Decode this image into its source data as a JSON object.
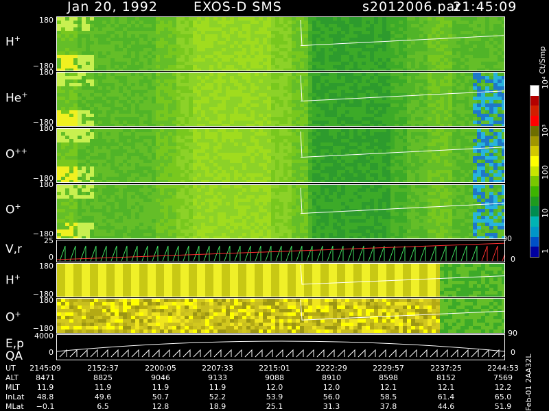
{
  "header": {
    "date": "Jan 20, 1992",
    "instrument": "EXOS-D SMS",
    "file": "s2012006.par",
    "time": "21:45:09"
  },
  "panels": [
    {
      "id": "h-plus",
      "label": "H",
      "sup": "+",
      "ticks": [
        "180",
        "−180"
      ]
    },
    {
      "id": "he-plus",
      "label": "He",
      "sup": "+",
      "ticks": [
        "180",
        "−180"
      ]
    },
    {
      "id": "o-plusplus",
      "label": "O",
      "sup": "++",
      "ticks": [
        "180",
        "−180"
      ]
    },
    {
      "id": "o-plus",
      "label": "O",
      "sup": "+",
      "ticks": [
        "180",
        "−180"
      ]
    },
    {
      "id": "vr",
      "label": "V,r",
      "sup": "",
      "ticks": [
        "25",
        "0"
      ],
      "right_ticks": [
        "90",
        "0"
      ]
    },
    {
      "id": "h-plus-2",
      "label": "H",
      "sup": "+",
      "ticks": [
        "180",
        "−180"
      ]
    },
    {
      "id": "o-plus-2",
      "label": "O",
      "sup": "+",
      "ticks": [
        "180",
        "−180"
      ]
    },
    {
      "id": "ep-qa",
      "label": "E,p",
      "label2": "QA",
      "ticks": [
        "4000",
        "0"
      ],
      "right_ticks": [
        "90",
        "0"
      ]
    }
  ],
  "colorbar": {
    "unit": "Ct/Smp",
    "labels": [
      "10⁴",
      "10³",
      "100",
      "10",
      "1"
    ],
    "colors": [
      "#ffffff",
      "#b40000",
      "#d21e00",
      "#ff0000",
      "#6e6e00",
      "#a09600",
      "#d2c800",
      "#ffff00",
      "#c8e600",
      "#78c800",
      "#3cb400",
      "#1e9b1e",
      "#008c50",
      "#00b4b4",
      "#0096c8",
      "#0050c8",
      "#0000a0"
    ]
  },
  "time_table": {
    "row_labels": [
      "UT",
      "ALT",
      "MLT",
      "InLat",
      "MLat"
    ],
    "columns": [
      [
        "2145:09",
        "8471",
        "11.9",
        "48.8",
        "−0.1"
      ],
      [
        "2152:37",
        "8825",
        "11.9",
        "49.6",
        "6.5"
      ],
      [
        "2200:05",
        "9046",
        "11.9",
        "50.7",
        "12.8"
      ],
      [
        "2207:33",
        "9133",
        "11.9",
        "52.2",
        "18.9"
      ],
      [
        "2215:01",
        "9088",
        "12.0",
        "53.9",
        "25.1"
      ],
      [
        "2222:29",
        "8910",
        "12.0",
        "56.0",
        "31.3"
      ],
      [
        "2229:57",
        "8598",
        "12.1",
        "58.5",
        "37.8"
      ],
      [
        "2237:25",
        "8152",
        "12.1",
        "61.4",
        "44.6"
      ],
      [
        "2244:53",
        "7569",
        "12.2",
        "65.0",
        "51.9"
      ]
    ]
  },
  "footer_side": "Feb-01 2AA32L"
}
